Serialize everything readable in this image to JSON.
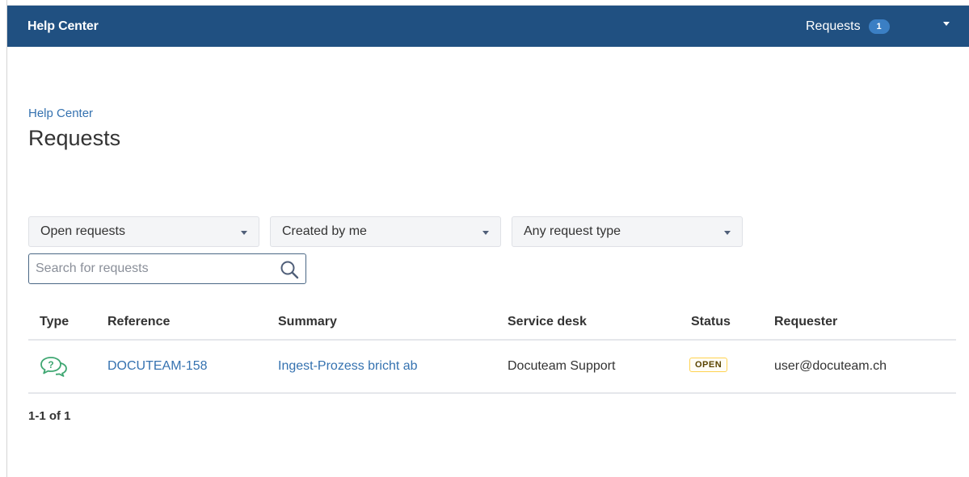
{
  "header": {
    "brand": "Help Center",
    "requests_label": "Requests",
    "requests_count": "1",
    "bg_color": "#205081",
    "badge_color": "#3b7fc4"
  },
  "breadcrumb": "Help Center",
  "page_title": "Requests",
  "filters": {
    "status": "Open requests",
    "creator": "Created by me",
    "request_type": "Any request type"
  },
  "search": {
    "placeholder": "Search for requests",
    "value": ""
  },
  "table": {
    "columns": [
      "Type",
      "Reference",
      "Summary",
      "Service desk",
      "Status",
      "Requester"
    ],
    "rows": [
      {
        "type_icon": "question-chat-icon",
        "reference": "DOCUTEAM-158",
        "summary": "Ingest-Prozess bricht ab",
        "service_desk": "Docuteam Support",
        "status": "OPEN",
        "requester": "user@docuteam.ch"
      }
    ]
  },
  "pagination": "1-1 of 1",
  "colors": {
    "link": "#3572b0",
    "status_border": "#ffd351",
    "type_icon": "#3fa772"
  }
}
